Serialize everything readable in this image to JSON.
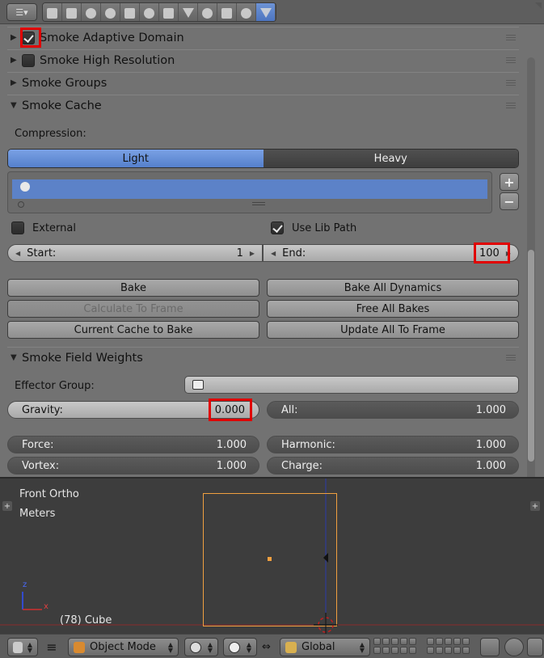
{
  "top_header": {
    "editor_icon": "properties-editor-icon",
    "context_icons": [
      "render-icon",
      "render-layers-icon",
      "scene-icon",
      "world-icon",
      "object-icon",
      "constraints-icon",
      "modifiers-icon",
      "data-icon",
      "material-icon",
      "texture-icon",
      "particles-icon",
      "physics-icon"
    ],
    "active_context": "physics-icon"
  },
  "panels": {
    "adaptive_domain": {
      "label": "Smoke Adaptive Domain",
      "checked": true
    },
    "high_resolution": {
      "label": "Smoke High Resolution",
      "checked": false
    },
    "groups": {
      "label": "Smoke Groups"
    },
    "cache": {
      "label": "Smoke Cache"
    },
    "field_weights": {
      "label": "Smoke Field Weights"
    }
  },
  "cache": {
    "compression_label": "Compression:",
    "compression_options": [
      "Light",
      "Heavy"
    ],
    "compression_selected": "Light",
    "external_label": "External",
    "external_checked": false,
    "use_lib_path_label": "Use Lib Path",
    "use_lib_path_checked": true,
    "start_label": "Start:",
    "start_value": "1",
    "end_label": "End:",
    "end_value": "100",
    "buttons": {
      "bake": "Bake",
      "bake_all": "Bake All Dynamics",
      "calc_to_frame": "Calculate To Frame",
      "free_all": "Free All Bakes",
      "current_to_bake": "Current Cache to Bake",
      "update_all": "Update All To Frame"
    }
  },
  "field_weights": {
    "effector_group_label": "Effector Group:",
    "gravity_label": "Gravity:",
    "gravity_value": "0.000",
    "all_label": "All:",
    "all_value": "1.000",
    "force_label": "Force:",
    "force_value": "1.000",
    "harmonic_label": "Harmonic:",
    "harmonic_value": "1.000",
    "vortex_label": "Vortex:",
    "vortex_value": "1.000",
    "charge_label": "Charge:",
    "charge_value": "1.000"
  },
  "viewport": {
    "view_name": "Front Ortho",
    "units": "Meters",
    "object_info": "(78) Cube",
    "axis_z": "z",
    "axis_x": "x",
    "colors": {
      "selection": "#f0a040",
      "z_axis": "#2a4aff",
      "x_axis": "#c03030",
      "background": "#3d3d3d"
    }
  },
  "bottom_header": {
    "mode": "Object Mode",
    "orientation": "Global"
  },
  "colors": {
    "accent": "#5c82c8",
    "highlight_box": "#e00000"
  }
}
